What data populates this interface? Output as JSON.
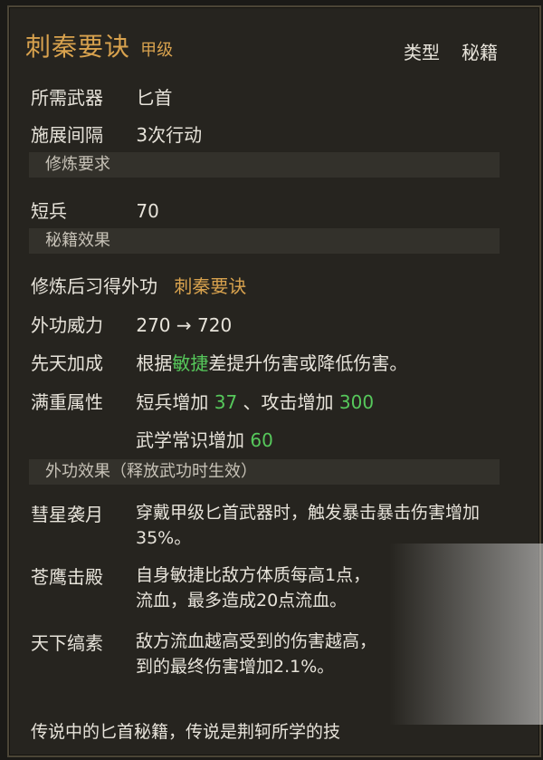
{
  "header": {
    "title": "刺秦要诀",
    "grade": "甲级",
    "type_label": "类型",
    "type_value": "秘籍"
  },
  "info": {
    "weapon_label": "所需武器",
    "weapon_value": "匕首",
    "interval_label": "施展间隔",
    "interval_value": "3次行动"
  },
  "sections": {
    "requirements": "修炼要求",
    "effects": "秘籍效果",
    "external_effects": "外功效果（释放武功时生效）"
  },
  "requirement": {
    "label": "短兵",
    "value": "70"
  },
  "effects": {
    "learn_label": "修炼后习得外功",
    "learn_value": "刺秦要诀",
    "power_label": "外功威力",
    "power_value": "270 → 720",
    "innate_label": "先天加成",
    "innate_text_a": "根据",
    "innate_highlight": "敏捷",
    "innate_text_b": "差提升伤害或降低伤害。",
    "full_label": "满重属性",
    "full_1_label": "短兵增加",
    "full_1_value": "37",
    "full_2_label": "、攻击增加",
    "full_2_value": "300",
    "full_3_label": "武学常识增加",
    "full_3_value": "60"
  },
  "external": [
    {
      "name": "彗星袭月",
      "lines": [
        "穿戴甲级匕首武器时，触发暴击暴击伤害增加",
        "35%。"
      ]
    },
    {
      "name": "苍鹰击殿",
      "lines": [
        "自身敏捷比敌方体质每高1点，",
        "流血，最多造成20点流血。"
      ]
    },
    {
      "name": "天下缟素",
      "lines": [
        "敌方流血越高受到的伤害越高，",
        "到的最终伤害增加2.1%。"
      ]
    }
  ],
  "footer": "传说中的匕首秘籍，传说是荆轲所学的技"
}
